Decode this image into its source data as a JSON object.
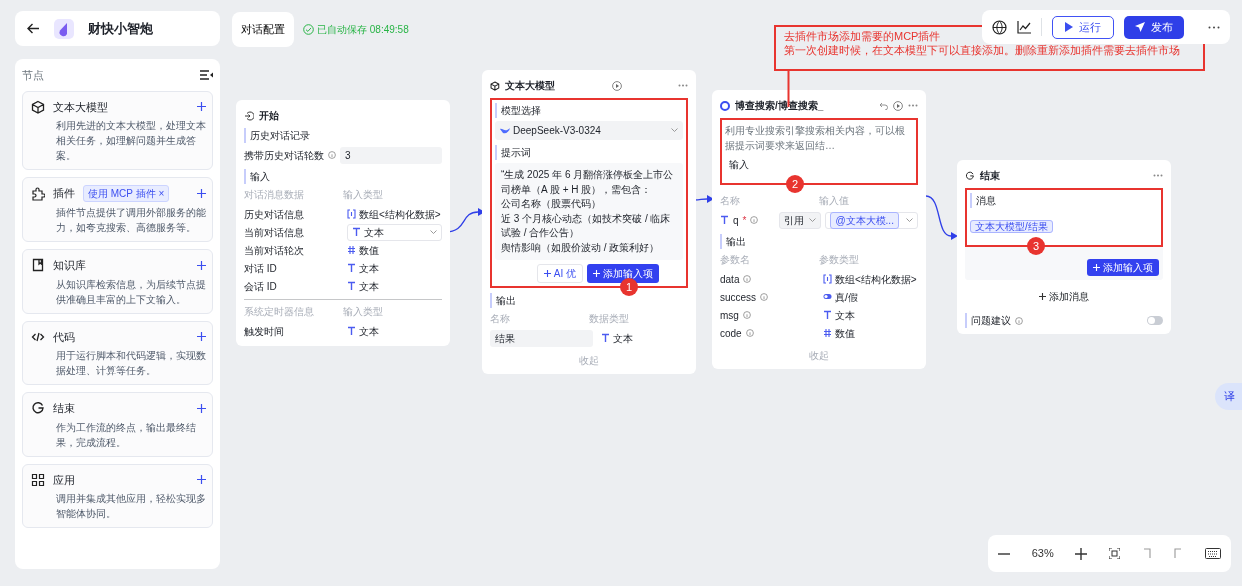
{
  "header": {
    "title": "财快小智炮"
  },
  "sidebar": {
    "title": "节点",
    "items": [
      {
        "kind": "llm",
        "title": "文本大模型",
        "description": "利用先进的文本大模型，处理文本相关任务，如理解问题并生成答案。"
      },
      {
        "kind": "plugin",
        "title": "插件",
        "tag": "使用 MCP 插件",
        "tag_close": "×",
        "description": "插件节点提供了调用外部服务的能力，如夸克搜索、高德服务等。"
      },
      {
        "kind": "knowledge",
        "title": "知识库",
        "description": "从知识库检索信息，为后续节点提供准确且丰富的上下文输入。"
      },
      {
        "kind": "code",
        "title": "代码",
        "description": "用于运行脚本和代码逻辑，实现数据处理、计算等任务。"
      },
      {
        "kind": "end",
        "title": "结束",
        "description": "作为工作流的终点，输出最终结果，完成流程。"
      },
      {
        "kind": "app",
        "title": "应用",
        "description": "调用并集成其他应用，轻松实现多智能体协同。"
      }
    ]
  },
  "config_tab": {
    "label": "对话配置"
  },
  "save_status": "已自动保存 08:49:58",
  "toolbar": {
    "run": "运行",
    "publish": "发布"
  },
  "nodes": [
    {
      "kind": "start",
      "title": "开始",
      "history_label": "历史对话记录",
      "rounds_label": "携带历史对话轮数",
      "rounds_value": "3",
      "input_label": "输入",
      "groups": [
        {
          "columns": [
            "对话消息数据",
            "输入类型"
          ],
          "rows": [
            {
              "name": "历史对话信息",
              "type": "数组<结构化数据>",
              "kind": "array",
              "select": false
            },
            {
              "name": "当前对话信息",
              "type": "文本",
              "kind": "text",
              "select": true
            },
            {
              "name": "当前对话轮次",
              "type": "数值",
              "kind": "number",
              "select": false
            },
            {
              "name": "对话 ID",
              "type": "文本",
              "kind": "text",
              "select": false
            },
            {
              "name": "会话 ID",
              "type": "文本",
              "kind": "text",
              "select": false
            }
          ]
        },
        {
          "columns": [
            "系统定时器信息",
            "输入类型"
          ],
          "rows": [
            {
              "name": "触发时间",
              "type": "文本",
              "kind": "text",
              "select": false
            }
          ]
        }
      ]
    },
    {
      "kind": "llm",
      "title": "文本大模型",
      "marker": "1",
      "model_label": "模型选择",
      "model": "DeepSeek-V3-0324",
      "prompt_label": "提示词",
      "prompt": [
        "“生成 2025 年 6 月翻倍涨停板全上市公司榜单（A 股 + H 股），需包含：",
        "公司名称（股票代码）",
        "近 3 个月核心动态（如技术突破 / 临床试验 / 合作公告）",
        "舆情影响（如股价波动 / 政策利好）"
      ],
      "ai_button": "AI 优",
      "add_button": "添加输入项",
      "output_label": "输出",
      "columns": [
        "名称",
        "数据类型"
      ],
      "outputs": [
        {
          "name": "结果",
          "type": "文本",
          "kind": "text"
        }
      ],
      "collapse": "收起"
    },
    {
      "kind": "plugin",
      "title": "博查搜索/博查搜索_",
      "marker": "2",
      "description": "利用专业搜索引擎搜索相关内容，可以根据提示词要求来返回结…",
      "input_label": "输入",
      "input_columns": [
        "名称",
        "输入值"
      ],
      "param": {
        "name": "q",
        "required": "*",
        "mode": "引用",
        "ref": "@文本大模..."
      },
      "output_label": "输出",
      "columns": [
        "参数名",
        "参数类型"
      ],
      "outputs": [
        {
          "name": "data",
          "type": "数组<结构化数据>",
          "kind": "array"
        },
        {
          "name": "success",
          "type": "真/假",
          "kind": "boolean"
        },
        {
          "name": "msg",
          "type": "文本",
          "kind": "text"
        },
        {
          "name": "code",
          "type": "数值",
          "kind": "number"
        }
      ],
      "collapse": "收起"
    },
    {
      "kind": "end",
      "title": "结束",
      "marker": "3",
      "message_label": "消息",
      "chip": "文本大模型/结果",
      "add_button": "添加输入项",
      "add_message": "添加消息",
      "suggest_label": "问题建议",
      "suggest_on": false
    }
  ],
  "note": {
    "lines": [
      "去插件市场添加需要的MCP插件",
      "第一次创建时候，在文本模型下可以直接添加。删除重新添加插件需要去插件市场"
    ]
  },
  "zoom_bar": {
    "zoom": "63%"
  },
  "translate_button": "译"
}
